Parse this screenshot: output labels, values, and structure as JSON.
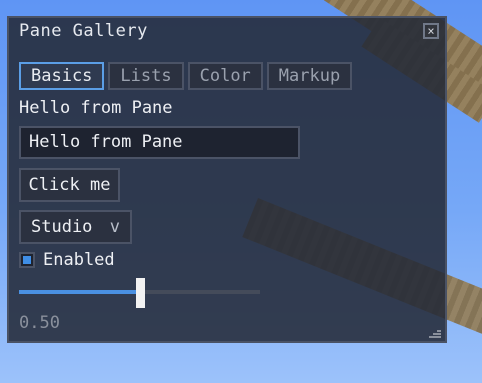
{
  "window": {
    "title": "Pane Gallery",
    "close_glyph": "×"
  },
  "tabs": [
    {
      "label": "Basics",
      "active": true
    },
    {
      "label": "Lists",
      "active": false
    },
    {
      "label": "Color",
      "active": false
    },
    {
      "label": "Markup",
      "active": false
    }
  ],
  "basics": {
    "label_text": "Hello from Pane",
    "textfield_value": "Hello from Pane",
    "button_label": "Click me",
    "select_value": "Studio",
    "select_chevron": "v",
    "checkbox_label": "Enabled",
    "checkbox_checked": true,
    "slider_value": 0.5,
    "slider_value_text": "0.50"
  },
  "colors": {
    "accent": "#4a90e2",
    "pane_bg": "#242a38"
  },
  "icons": {
    "close": "close-icon",
    "chevron": "chevron-down-icon",
    "resize": "resize-grip-icon"
  }
}
